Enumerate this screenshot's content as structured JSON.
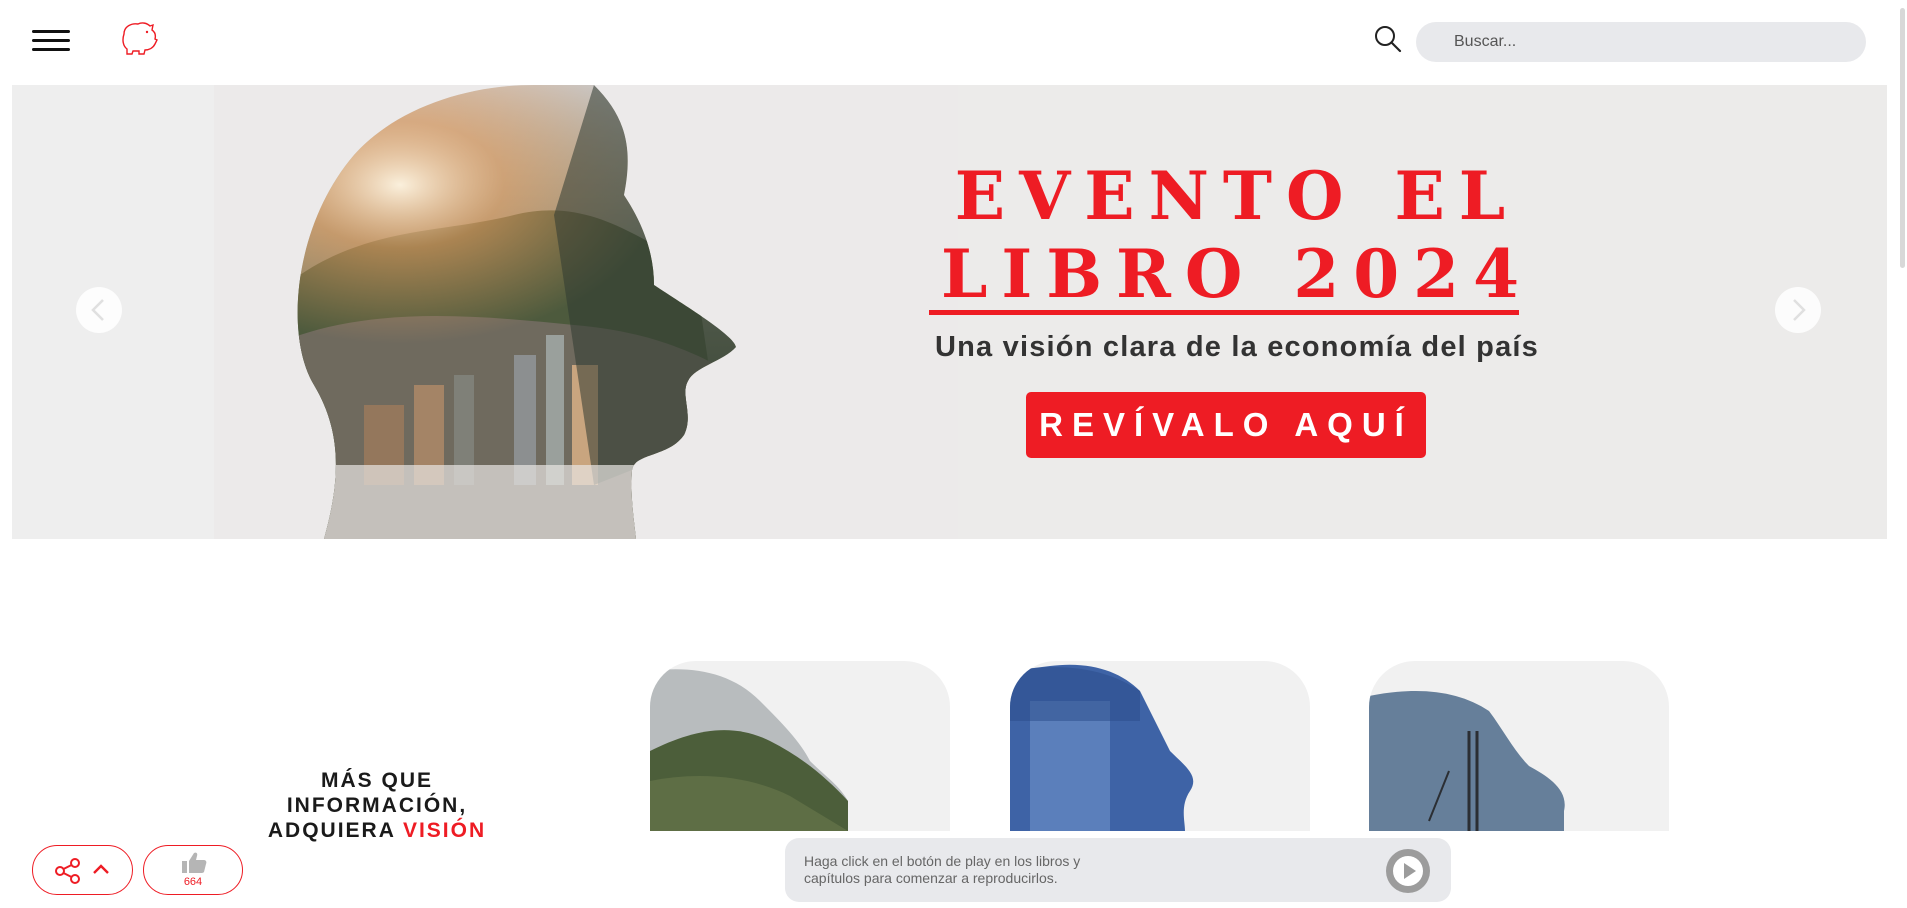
{
  "header": {
    "menu_icon": "hamburger-menu-icon",
    "logo_icon": "piggy-bank-logo-icon",
    "search_icon": "search-icon",
    "search_placeholder": "Buscar..."
  },
  "hero": {
    "title_line1": "EVENTO EL",
    "title_line2": "LIBRO 2024",
    "subtitle": "Una visión clara de la economía del país",
    "cta_label": "REVÍVALO AQUÍ",
    "prev_icon": "chevron-left-icon",
    "next_icon": "chevron-right-icon"
  },
  "section": {
    "heading_line1": "MÁS QUE INFORMACIÓN,",
    "heading_line2_prefix": "ADQUIERA ",
    "heading_line2_accent": "VISIÓN"
  },
  "cards": [
    {
      "theme": "mountain-city-profile"
    },
    {
      "theme": "glass-building-profile"
    },
    {
      "theme": "crane-construction-profile"
    }
  ],
  "bottom": {
    "share_icon": "share-icon",
    "chevron_icon": "chevron-up-icon",
    "like_icon": "thumbs-up-icon",
    "like_count": "664",
    "player_text": "Haga click en el botón de play en los libros y capítulos para comenzar a reproducirlos.",
    "play_icon": "play-icon"
  },
  "colors": {
    "accent": "#ee1c24",
    "search_bg": "#e8e9ec",
    "hero_bg": "#ecebea"
  }
}
